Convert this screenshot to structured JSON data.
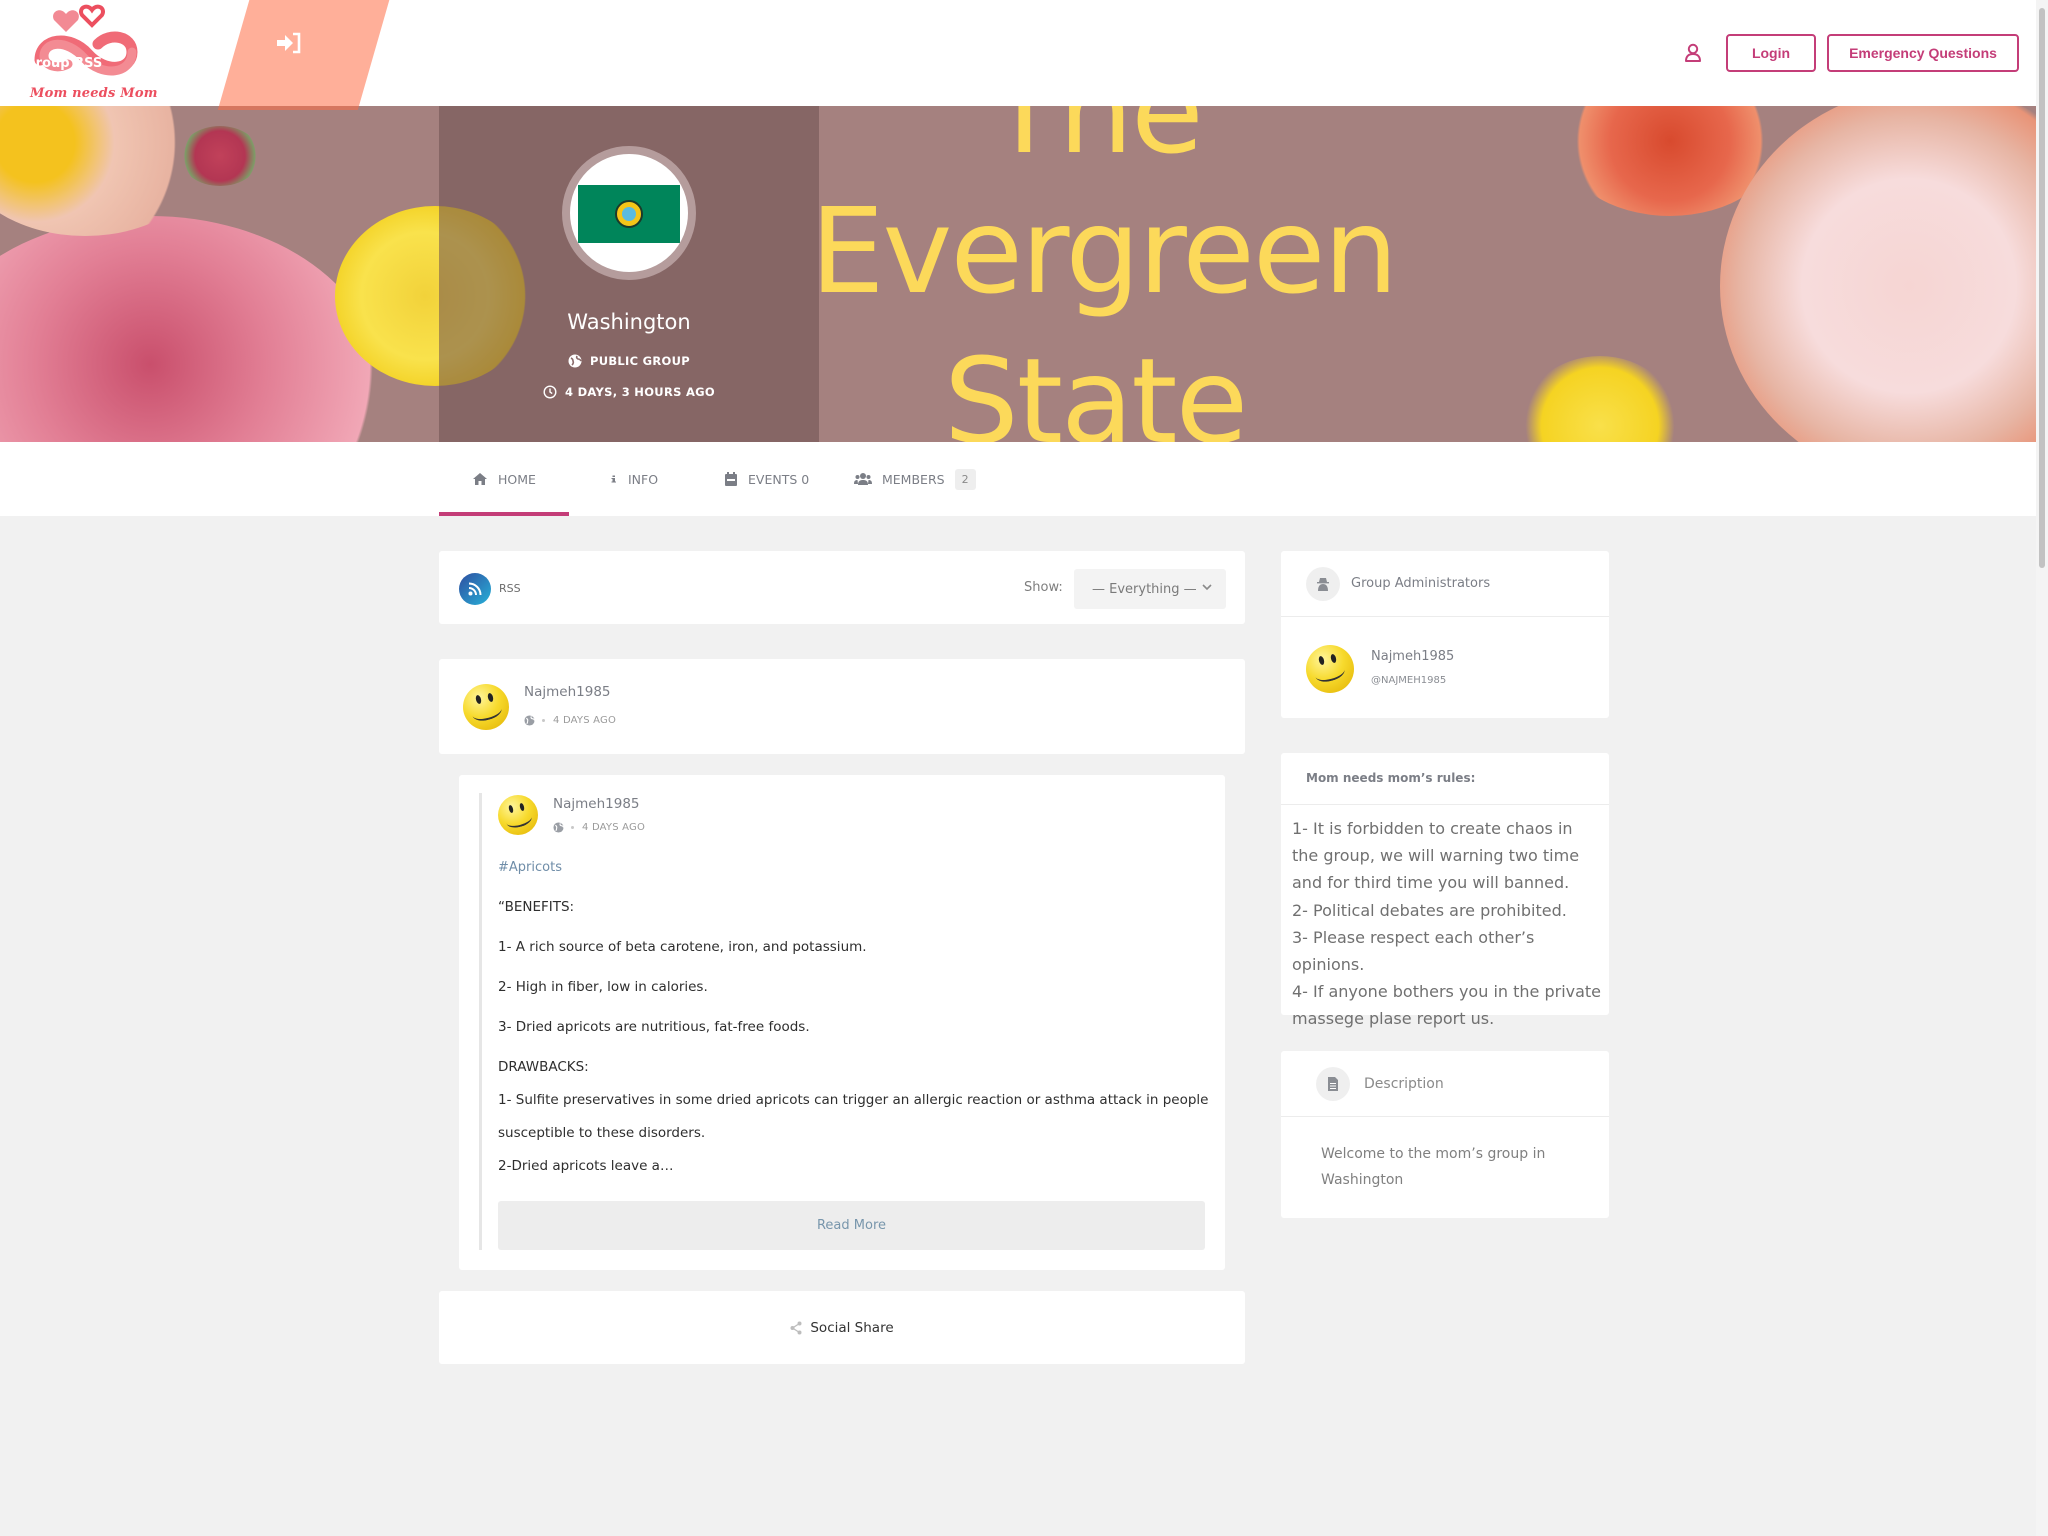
{
  "header": {
    "logo_text": "Mom needs Mom",
    "login_label": "Login",
    "emergency_label": "Emergency Questions",
    "user_icon": "user-icon"
  },
  "banner": {
    "title_lines": [
      "The",
      "Evergreen",
      "State"
    ],
    "group_name": "Washington",
    "group_type": "PUBLIC GROUP",
    "group_time": "4 DAYS, 3 HOURS AGO"
  },
  "tabs": [
    {
      "label": "HOME",
      "icon": "home-icon",
      "active": true
    },
    {
      "label": "INFO",
      "icon": "info-icon"
    },
    {
      "label": "EVENTS 0",
      "icon": "calendar-icon"
    },
    {
      "label": "MEMBERS",
      "icon": "users-icon",
      "count": "2"
    }
  ],
  "filter": {
    "rss_label": "RSS",
    "show_label": "Show:",
    "selected": "— Everything —"
  },
  "post": {
    "author": "Najmeh1985",
    "time": "4 DAYS AGO",
    "shared": {
      "author": "Najmeh1985",
      "time": "4 DAYS AGO",
      "hashtag": "#Apricots",
      "lines": [
        "“BENEFITS:",
        "1- A rich source of beta carotene, iron, and potassium.",
        "2- High in fiber, low in calories.",
        "3- Dried apricots are nutritious, fat-free foods.",
        "DRAWBACKS:",
        "1- Sulfite preservatives in some dried apricots can trigger an allergic reaction or asthma attack in people",
        "susceptible to these disorders.",
        "2-Dried apricots leave a…"
      ],
      "read_more": "Read More"
    },
    "social_share": "Social Share"
  },
  "sidebar": {
    "admins": {
      "title": "Group Administrators",
      "name": "Najmeh1985",
      "handle": "@NAJMEH1985"
    },
    "rules": {
      "title": "Mom needs mom’s rules:",
      "text": "1- It is forbidden to create chaos in the group, we will warning two time and for third time you will banned.\n2- Political debates are prohibited.\n3- Please respect each other’s opinions.\n4- If anyone bothers you in the private massege plase report us."
    },
    "description": {
      "title": "Description",
      "text": "Welcome to the mom’s group in Washington"
    },
    "rss_widget": {
      "label": "Group RSS"
    }
  },
  "colors": {
    "accent": "#c43d78",
    "banner_bg": "#a5817f",
    "banner_text": "#fcd95a",
    "logo": "#ec4f5f",
    "rss_gradient": [
      "#f7d322",
      "#fd7d24"
    ]
  }
}
